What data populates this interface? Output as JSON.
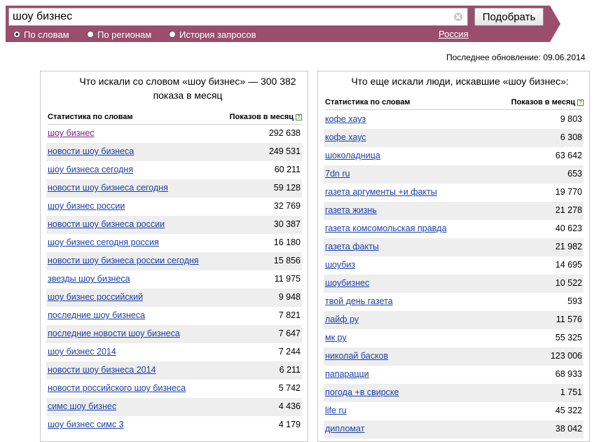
{
  "search": {
    "query": "шоу бизнес",
    "button_label": "Подобрать"
  },
  "tabs": [
    {
      "label": "По словам",
      "selected": true
    },
    {
      "label": "По регионам",
      "selected": false
    },
    {
      "label": "История запросов",
      "selected": false
    }
  ],
  "region_link": "Россия",
  "last_update": "Последнее обновление: 09.06.2014",
  "colors": {
    "header_bar": "#9a4e6c",
    "link": "#1a3fa8",
    "visited_link": "#8a1a8a",
    "row_shade": "#eeeeee"
  },
  "left_panel": {
    "title": "Что искали со словом «шоу бизнес» — 300 382 показа в месяц",
    "col_phrase": "Статистика по словам",
    "col_count": "Показов в месяц",
    "rows": [
      {
        "phrase": "шоу бизнес",
        "count": "292 638"
      },
      {
        "phrase": "новости шоу бизнеса",
        "count": "249 531"
      },
      {
        "phrase": "шоу бизнеса сегодня",
        "count": "60 211"
      },
      {
        "phrase": "новости шоу бизнеса сегодня",
        "count": "59 128"
      },
      {
        "phrase": "шоу бизнес россии",
        "count": "32 769"
      },
      {
        "phrase": "новости шоу бизнеса россии",
        "count": "30 387"
      },
      {
        "phrase": "шоу бизнес сегодня россия",
        "count": "16 180"
      },
      {
        "phrase": "новости шоу бизнеса россии сегодня",
        "count": "15 856"
      },
      {
        "phrase": "звезды шоу бизнеса",
        "count": "11 975"
      },
      {
        "phrase": "шоу бизнес российский",
        "count": "9 948"
      },
      {
        "phrase": "последние шоу бизнеса",
        "count": "7 821"
      },
      {
        "phrase": "последние новости шоу бизнеса",
        "count": "7 647"
      },
      {
        "phrase": "шоу бизнес 2014",
        "count": "7 244"
      },
      {
        "phrase": "новости шоу бизнеса 2014",
        "count": "6 211"
      },
      {
        "phrase": "новости российского шоу бизнеса",
        "count": "5 742"
      },
      {
        "phrase": "симс шоу бизнес",
        "count": "4 436"
      },
      {
        "phrase": "шоу бизнес симс 3",
        "count": "4 179"
      }
    ]
  },
  "right_panel": {
    "title": "Что еще искали люди, искавшие «шоу бизнес»:",
    "col_phrase": "Статистика по словам",
    "col_count": "Показов в месяц",
    "rows": [
      {
        "phrase": "кофе хауз",
        "count": "9 803"
      },
      {
        "phrase": "кофе хаус",
        "count": "6 308"
      },
      {
        "phrase": "шоколадница",
        "count": "63 642"
      },
      {
        "phrase": "7dn ru",
        "count": "653"
      },
      {
        "phrase": "газета аргументы +и факты",
        "count": "19 770"
      },
      {
        "phrase": "газета жизнь",
        "count": "21 278"
      },
      {
        "phrase": "газета комсомольская правда",
        "count": "40 623"
      },
      {
        "phrase": "газета факты",
        "count": "21 982"
      },
      {
        "phrase": "шоубиз",
        "count": "14 695"
      },
      {
        "phrase": "шоубизнес",
        "count": "10 522"
      },
      {
        "phrase": "твой день газета",
        "count": "593"
      },
      {
        "phrase": "лайф ру",
        "count": "11 576"
      },
      {
        "phrase": "мк ру",
        "count": "55 325"
      },
      {
        "phrase": "николай басков",
        "count": "123 006"
      },
      {
        "phrase": "папарацци",
        "count": "68 933"
      },
      {
        "phrase": "погода +в свирске",
        "count": "1 751"
      },
      {
        "phrase": "life ru",
        "count": "45 322"
      },
      {
        "phrase": "дипломат",
        "count": "38 042"
      }
    ]
  }
}
